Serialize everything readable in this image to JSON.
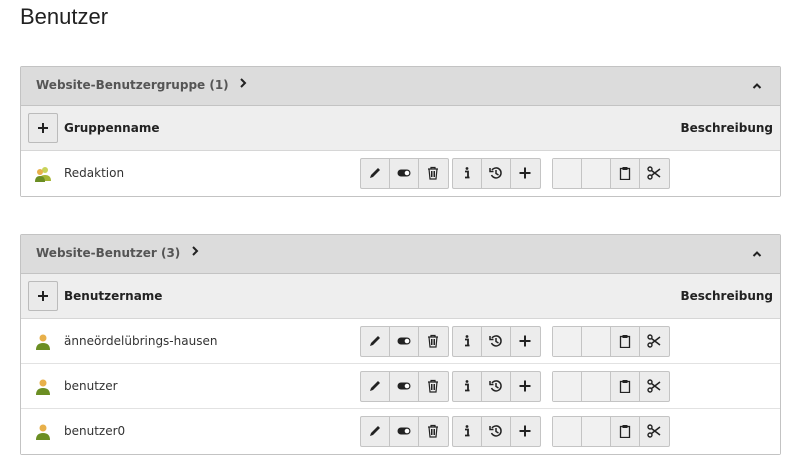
{
  "page": {
    "title": "Benutzer"
  },
  "panels": [
    {
      "title": "Website-Benutzergruppe (1)",
      "col_name": "Gruppenname",
      "col_desc": "Beschreibung",
      "rows": [
        {
          "label": "Redaktion"
        }
      ]
    },
    {
      "title": "Website-Benutzer (3)",
      "col_name": "Benutzername",
      "col_desc": "Beschreibung",
      "rows": [
        {
          "label": "änneördelübrings-hausen"
        },
        {
          "label": "benutzer"
        },
        {
          "label": "benutzer0"
        }
      ]
    }
  ],
  "icons": {
    "group_record": "user-group-icon",
    "user_record": "user-icon",
    "edit": "pencil-icon",
    "toggle": "toggle-icon",
    "delete": "trash-icon",
    "info": "info-icon",
    "history": "history-icon",
    "new": "plus-icon",
    "paste": "clipboard-icon",
    "cut": "scissors-icon",
    "expand": "chevron-right-icon",
    "collapse": "chevron-up-icon"
  },
  "colors": {
    "header_bg": "#dcdcdc",
    "column_bar_bg": "#eeeeee",
    "user_icon_body": "#6b8e23",
    "user_icon_head": "#e8b04a"
  }
}
